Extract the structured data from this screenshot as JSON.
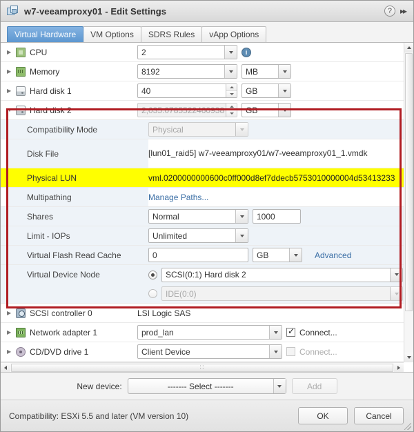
{
  "window": {
    "title": "w7-veeamproxy01 - Edit Settings",
    "icon": "vm-icon",
    "help_icon": "?",
    "collapse_icon": "▸▸"
  },
  "tabs": [
    {
      "label": "Virtual Hardware",
      "active": true
    },
    {
      "label": "VM Options",
      "active": false
    },
    {
      "label": "SDRS Rules",
      "active": false
    },
    {
      "label": "vApp Options",
      "active": false
    }
  ],
  "hardware": {
    "cpu": {
      "label": "CPU",
      "value": "2",
      "info_icon": "i"
    },
    "memory": {
      "label": "Memory",
      "value": "8192",
      "unit": "MB"
    },
    "hard_disk_1": {
      "label": "Hard disk 1",
      "value": "40",
      "unit": "GB"
    },
    "hard_disk_2": {
      "label": "Hard disk 2",
      "value": "2,035.0785522460938",
      "unit": "GB",
      "compatibility_mode_label": "Compatibility Mode",
      "compatibility_mode_value": "Physical",
      "disk_file_label": "Disk File",
      "disk_file_value": "[lun01_raid5] w7-veeamproxy01/w7-veeamproxy01_1.vmdk",
      "physical_lun_label": "Physical LUN",
      "physical_lun_value": "vml.0200000000600c0ff000d8ef7ddecb5753010000004d53413233",
      "multipathing_label": "Multipathing",
      "multipathing_link": "Manage Paths...",
      "shares_label": "Shares",
      "shares_value": "Normal",
      "shares_number": "1000",
      "limit_iops_label": "Limit - IOPs",
      "limit_iops_value": "Unlimited",
      "vfrc_label": "Virtual Flash Read Cache",
      "vfrc_value": "0",
      "vfrc_unit": "GB",
      "vfrc_advanced": "Advanced",
      "node_label": "Virtual Device Node",
      "node_scsi_value": "SCSI(0:1) Hard disk 2",
      "node_ide_value": "IDE(0:0)"
    },
    "scsi_controller_0": {
      "label": "SCSI controller 0",
      "value": "LSI Logic SAS"
    },
    "network_adapter_1": {
      "label": "Network adapter 1",
      "value": "prod_lan",
      "connect_label": "Connect...",
      "connected": true
    },
    "cddvd_drive_1": {
      "label": "CD/DVD drive 1",
      "value": "Client Device",
      "connect_label": "Connect...",
      "connected": false
    }
  },
  "new_device": {
    "label": "New device:",
    "select_value": "------- Select -------",
    "add_label": "Add"
  },
  "footer": {
    "compatibility": "Compatibility: ESXi 5.5 and later (VM version 10)",
    "ok_label": "OK",
    "cancel_label": "Cancel"
  },
  "colors": {
    "highlight_box": "#b01c22",
    "lun_highlight": "#ffff00",
    "active_tab": "#5d97d0",
    "link": "#3a6ea5"
  }
}
